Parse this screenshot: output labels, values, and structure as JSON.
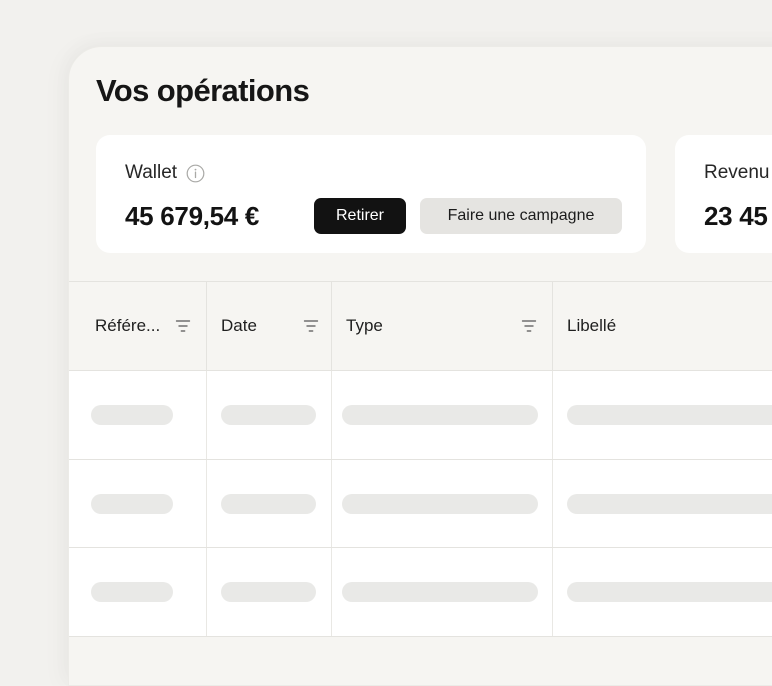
{
  "page": {
    "title": "Vos opérations"
  },
  "wallet": {
    "label": "Wallet",
    "amount": "45 679,54 €",
    "withdraw_label": "Retirer",
    "campaign_label": "Faire une campagne"
  },
  "revenue": {
    "label": "Revenu",
    "amount": "23 45"
  },
  "table": {
    "columns": [
      {
        "label": "Référe...",
        "filter_icon": "filter-icon"
      },
      {
        "label": "Date",
        "filter_icon": "filter-icon"
      },
      {
        "label": "Type",
        "filter_icon": "filter-icon"
      },
      {
        "label": "Libellé"
      }
    ],
    "loading_rows": 3
  },
  "colors": {
    "background": "#f2f1ee",
    "panel": "#f6f5f2",
    "card": "#ffffff",
    "primary_button": "#121212",
    "secondary_button": "#e5e4e1",
    "skeleton": "#e9e9e7"
  }
}
